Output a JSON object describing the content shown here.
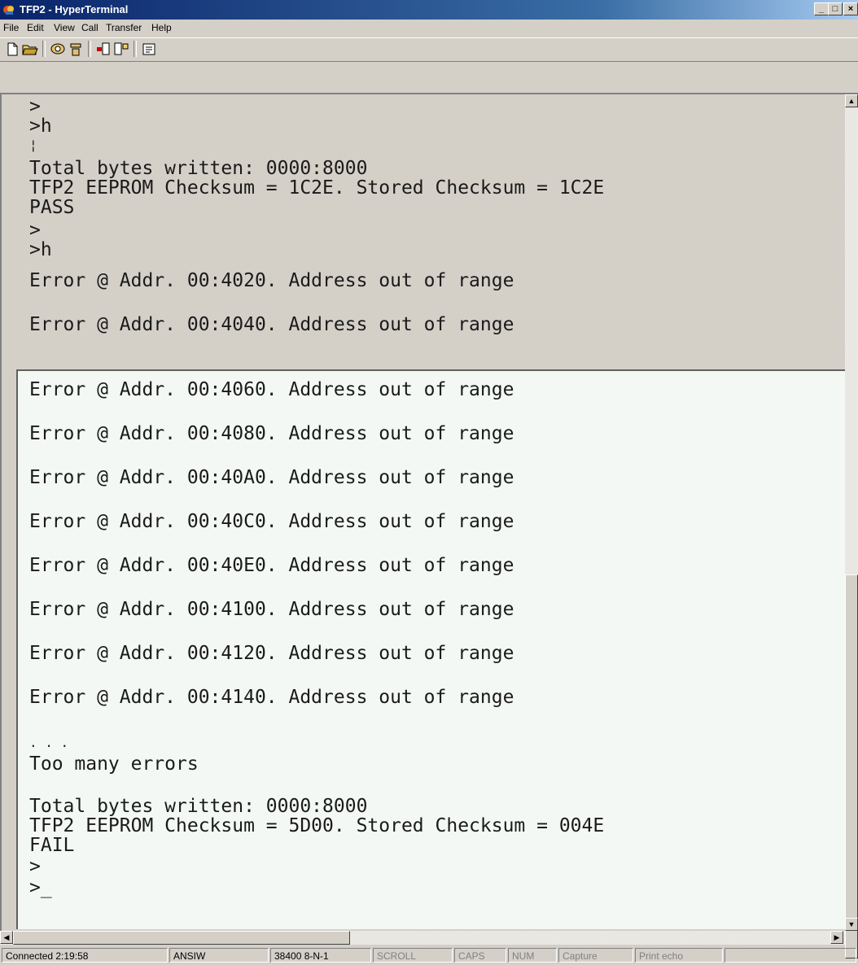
{
  "window": {
    "title": "TFP2 - HyperTerminal"
  },
  "menu": [
    "File",
    "Edit",
    "View",
    "Call",
    "Transfer",
    "Help"
  ],
  "toolbar": [
    "new-icon",
    "open-icon",
    "connect-icon",
    "disconnect-icon",
    "send-icon",
    "receive-icon",
    "properties-icon"
  ],
  "terminal": {
    "top_lines": [
      ">",
      ">h",
      "¦",
      "Total bytes written: 0000:8000",
      "TFP2 EEPROM Checksum = 1C2E. Stored Checksum = 1C2E",
      "PASS",
      ">",
      ">h",
      "Error @ Addr. 00:4020. Address out of range",
      "Error @ Addr. 00:4040. Address out of range"
    ],
    "bottom_lines": [
      "Error @ Addr. 00:4060. Address out of range",
      "Error @ Addr. 00:4080. Address out of range",
      "Error @ Addr. 00:40A0. Address out of range",
      "Error @ Addr. 00:40C0. Address out of range",
      "Error @ Addr. 00:40E0. Address out of range",
      "Error @ Addr. 00:4100. Address out of range",
      "Error @ Addr. 00:4120. Address out of range",
      "Error @ Addr. 00:4140. Address out of range",
      ". . .",
      "Too many errors",
      "Total bytes written: 0000:8000",
      "TFP2 EEPROM Checksum = 5D00. Stored Checksum = 004E",
      "FAIL",
      ">",
      ">_"
    ]
  },
  "status": {
    "connected": "Connected 2:19:58",
    "emulation": "ANSIW",
    "port": "38400 8-N-1",
    "scroll": "SCROLL",
    "caps": "CAPS",
    "num": "NUM",
    "capture": "Capture",
    "print_echo": "Print echo"
  }
}
